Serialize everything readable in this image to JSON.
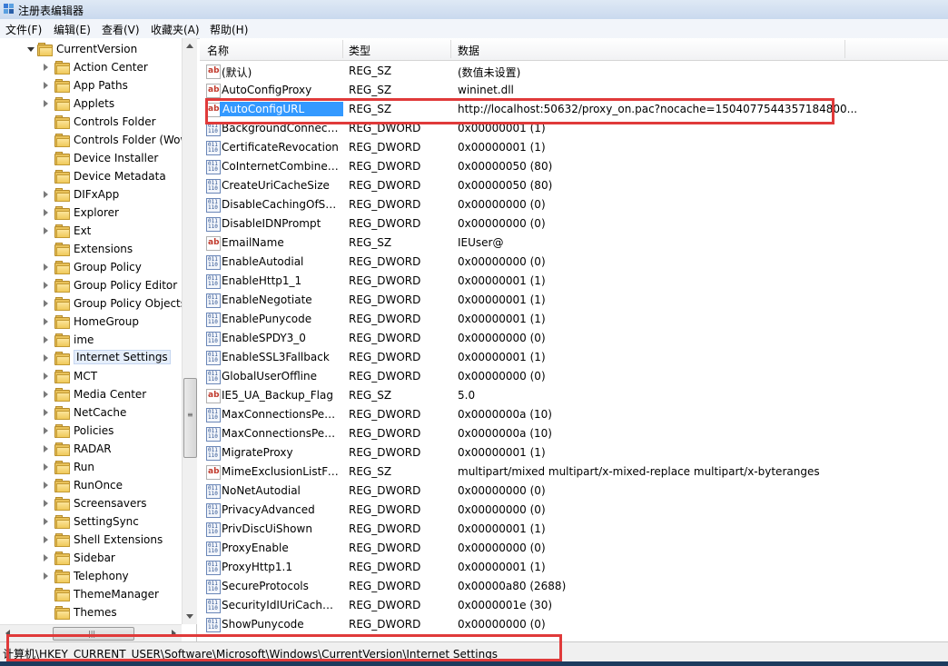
{
  "window": {
    "title": "注册表编辑器"
  },
  "menu": [
    "文件(F)",
    "编辑(E)",
    "查看(V)",
    "收藏夹(A)",
    "帮助(H)"
  ],
  "tree": {
    "root": "CurrentVersion",
    "selected": "Internet Settings",
    "items": [
      "Action Center",
      "App Paths",
      "Applets",
      "Controls Folder",
      "Controls Folder (Wow",
      "Device Installer",
      "Device Metadata",
      "DIFxApp",
      "Explorer",
      "Ext",
      "Extensions",
      "Group Policy",
      "Group Policy Editor",
      "Group Policy Objects",
      "HomeGroup",
      "ime",
      "Internet Settings",
      "MCT",
      "Media Center",
      "NetCache",
      "Policies",
      "RADAR",
      "Run",
      "RunOnce",
      "Screensavers",
      "SettingSync",
      "Shell Extensions",
      "Sidebar",
      "Telephony",
      "ThemeManager",
      "Themes"
    ]
  },
  "columns": {
    "name": "名称",
    "type": "类型",
    "data": "数据"
  },
  "values": [
    {
      "name": "(默认)",
      "type": "REG_SZ",
      "data": "(数值未设置)",
      "icon": "string-value-icon"
    },
    {
      "name": "AutoConfigProxy",
      "type": "REG_SZ",
      "data": "wininet.dll",
      "icon": "string-value-icon"
    },
    {
      "name": "AutoConfigURL",
      "type": "REG_SZ",
      "data": "http://localhost:50632/proxy_on.pac?nocache=1504077544357184800...",
      "icon": "string-value-icon",
      "selected": true
    },
    {
      "name": "BackgroundConnecti...",
      "type": "REG_DWORD",
      "data": "0x00000001 (1)",
      "icon": "dword-value-icon"
    },
    {
      "name": "CertificateRevocation",
      "type": "REG_DWORD",
      "data": "0x00000001 (1)",
      "icon": "dword-value-icon"
    },
    {
      "name": "CoInternetCombineI...",
      "type": "REG_DWORD",
      "data": "0x00000050 (80)",
      "icon": "dword-value-icon"
    },
    {
      "name": "CreateUriCacheSize",
      "type": "REG_DWORD",
      "data": "0x00000050 (80)",
      "icon": "dword-value-icon"
    },
    {
      "name": "DisableCachingOfSSL...",
      "type": "REG_DWORD",
      "data": "0x00000000 (0)",
      "icon": "dword-value-icon"
    },
    {
      "name": "DisableIDNPrompt",
      "type": "REG_DWORD",
      "data": "0x00000000 (0)",
      "icon": "dword-value-icon"
    },
    {
      "name": "EmailName",
      "type": "REG_SZ",
      "data": "IEUser@",
      "icon": "string-value-icon"
    },
    {
      "name": "EnableAutodial",
      "type": "REG_DWORD",
      "data": "0x00000000 (0)",
      "icon": "dword-value-icon"
    },
    {
      "name": "EnableHttp1_1",
      "type": "REG_DWORD",
      "data": "0x00000001 (1)",
      "icon": "dword-value-icon"
    },
    {
      "name": "EnableNegotiate",
      "type": "REG_DWORD",
      "data": "0x00000001 (1)",
      "icon": "dword-value-icon"
    },
    {
      "name": "EnablePunycode",
      "type": "REG_DWORD",
      "data": "0x00000001 (1)",
      "icon": "dword-value-icon"
    },
    {
      "name": "EnableSPDY3_0",
      "type": "REG_DWORD",
      "data": "0x00000000 (0)",
      "icon": "dword-value-icon"
    },
    {
      "name": "EnableSSL3Fallback",
      "type": "REG_DWORD",
      "data": "0x00000001 (1)",
      "icon": "dword-value-icon"
    },
    {
      "name": "GlobalUserOffline",
      "type": "REG_DWORD",
      "data": "0x00000000 (0)",
      "icon": "dword-value-icon"
    },
    {
      "name": "IE5_UA_Backup_Flag",
      "type": "REG_SZ",
      "data": "5.0",
      "icon": "string-value-icon"
    },
    {
      "name": "MaxConnectionsPer1...",
      "type": "REG_DWORD",
      "data": "0x0000000a (10)",
      "icon": "dword-value-icon"
    },
    {
      "name": "MaxConnectionsPerS...",
      "type": "REG_DWORD",
      "data": "0x0000000a (10)",
      "icon": "dword-value-icon"
    },
    {
      "name": "MigrateProxy",
      "type": "REG_DWORD",
      "data": "0x00000001 (1)",
      "icon": "dword-value-icon"
    },
    {
      "name": "MimeExclusionListFo...",
      "type": "REG_SZ",
      "data": "multipart/mixed multipart/x-mixed-replace multipart/x-byteranges",
      "icon": "string-value-icon"
    },
    {
      "name": "NoNetAutodial",
      "type": "REG_DWORD",
      "data": "0x00000000 (0)",
      "icon": "dword-value-icon"
    },
    {
      "name": "PrivacyAdvanced",
      "type": "REG_DWORD",
      "data": "0x00000000 (0)",
      "icon": "dword-value-icon"
    },
    {
      "name": "PrivDiscUiShown",
      "type": "REG_DWORD",
      "data": "0x00000001 (1)",
      "icon": "dword-value-icon"
    },
    {
      "name": "ProxyEnable",
      "type": "REG_DWORD",
      "data": "0x00000000 (0)",
      "icon": "dword-value-icon"
    },
    {
      "name": "ProxyHttp1.1",
      "type": "REG_DWORD",
      "data": "0x00000001 (1)",
      "icon": "dword-value-icon"
    },
    {
      "name": "SecureProtocols",
      "type": "REG_DWORD",
      "data": "0x00000a80 (2688)",
      "icon": "dword-value-icon"
    },
    {
      "name": "SecurityIdIUriCacheSi...",
      "type": "REG_DWORD",
      "data": "0x0000001e (30)",
      "icon": "dword-value-icon"
    },
    {
      "name": "ShowPunycode",
      "type": "REG_DWORD",
      "data": "0x00000000 (0)",
      "icon": "dword-value-icon"
    }
  ],
  "statusbar": {
    "path": "计算机\\HKEY_CURRENT_USER\\Software\\Microsoft\\Windows\\CurrentVersion\\Internet Settings"
  },
  "colors": {
    "highlight": "#e03a3a",
    "selection": "#3399ff"
  }
}
